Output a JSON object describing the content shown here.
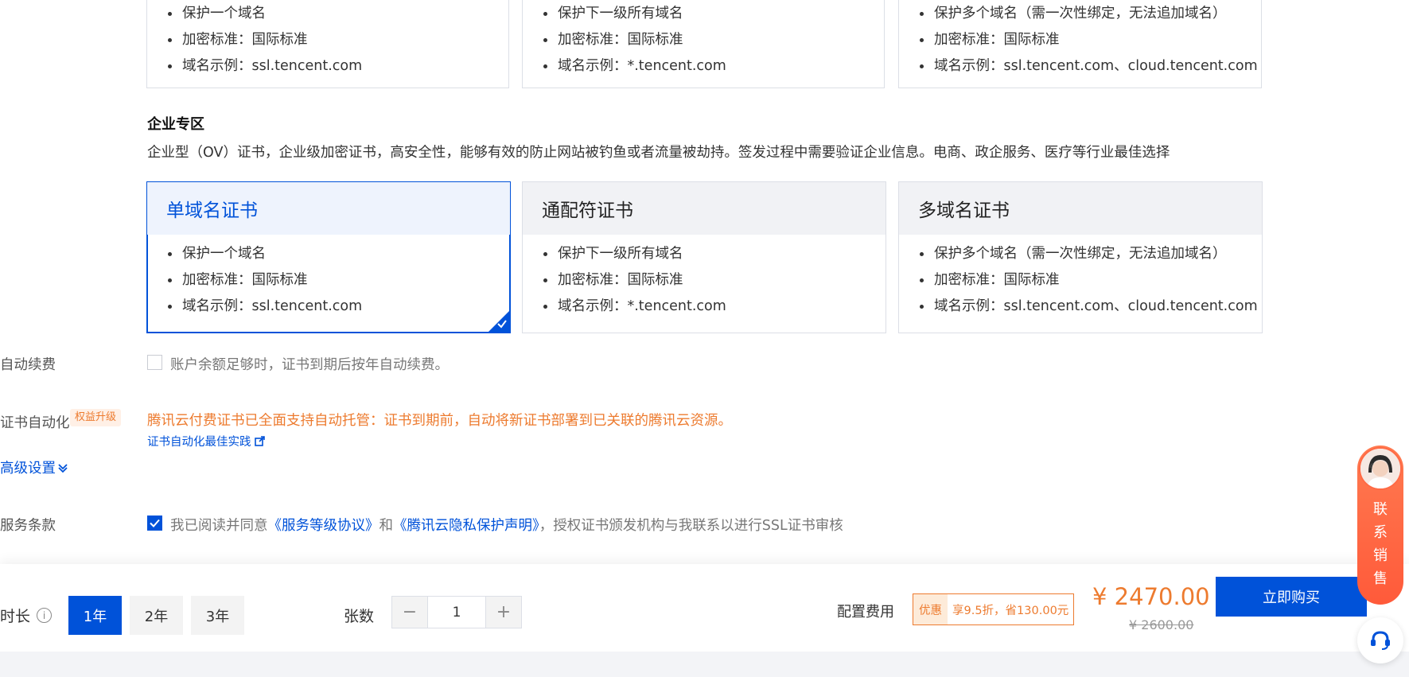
{
  "top_cards": [
    {
      "items": [
        "保护一个域名",
        "加密标准：国际标准",
        "域名示例：ssl.tencent.com"
      ]
    },
    {
      "items": [
        "保护下一级所有域名",
        "加密标准：国际标准",
        "域名示例：*.tencent.com"
      ]
    },
    {
      "items": [
        "保护多个域名（需一次性绑定，无法追加域名）",
        "加密标准：国际标准",
        "域名示例：ssl.tencent.com、cloud.tencent.com"
      ]
    }
  ],
  "enterprise": {
    "title": "企业专区",
    "description": "企业型（OV）证书，企业级加密证书，高安全性，能够有效的防止网站被钓鱼或者流量被劫持。签发过程中需要验证企业信息。电商、政企服务、医疗等行业最佳选择",
    "cards": [
      {
        "title": "单域名证书",
        "selected": true,
        "items": [
          "保护一个域名",
          "加密标准：国际标准",
          "域名示例：ssl.tencent.com"
        ]
      },
      {
        "title": "通配符证书",
        "selected": false,
        "items": [
          "保护下一级所有域名",
          "加密标准：国际标准",
          "域名示例：*.tencent.com"
        ]
      },
      {
        "title": "多域名证书",
        "selected": false,
        "items": [
          "保护多个域名（需一次性绑定，无法追加域名）",
          "加密标准：国际标准",
          "域名示例：ssl.tencent.com、cloud.tencent.com"
        ]
      }
    ]
  },
  "auto_renew": {
    "label": "自动续费",
    "checked": false,
    "text": "账户余额足够时，证书到期后按年自动续费。"
  },
  "automation": {
    "label": "证书自动化",
    "badge": "权益升级",
    "notice": "腾讯云付费证书已全面支持自动托管：证书到期前，自动将新证书部署到已关联的腾讯云资源。",
    "link": "证书自动化最佳实践"
  },
  "advanced": {
    "label": "高级设置"
  },
  "terms": {
    "label": "服务条款",
    "checked": true,
    "prefix": "我已阅读并同意",
    "link1": "《服务等级协议》",
    "and": "和",
    "link2": "《腾讯云隐私保护声明》",
    "suffix": "，授权证书颁发机构与我联系以进行SSL证书审核"
  },
  "footer": {
    "duration_label": "时长",
    "durations": [
      "1年",
      "2年",
      "3年"
    ],
    "selected_duration": "1年",
    "qty_label": "张数",
    "qty_value": "1",
    "minus": "−",
    "plus": "+",
    "fee_label": "配置费用",
    "promo_tag": "优惠",
    "promo_text": "享9.5折，省130.00元",
    "price": "¥ 2470.00",
    "original_price": "¥ 2600.00",
    "buy_label": "立即购买"
  },
  "contact": {
    "text": "联系销售"
  },
  "colors": {
    "primary": "#0052d9",
    "orange": "#ed7b2f",
    "contact": "#ff6a45"
  }
}
